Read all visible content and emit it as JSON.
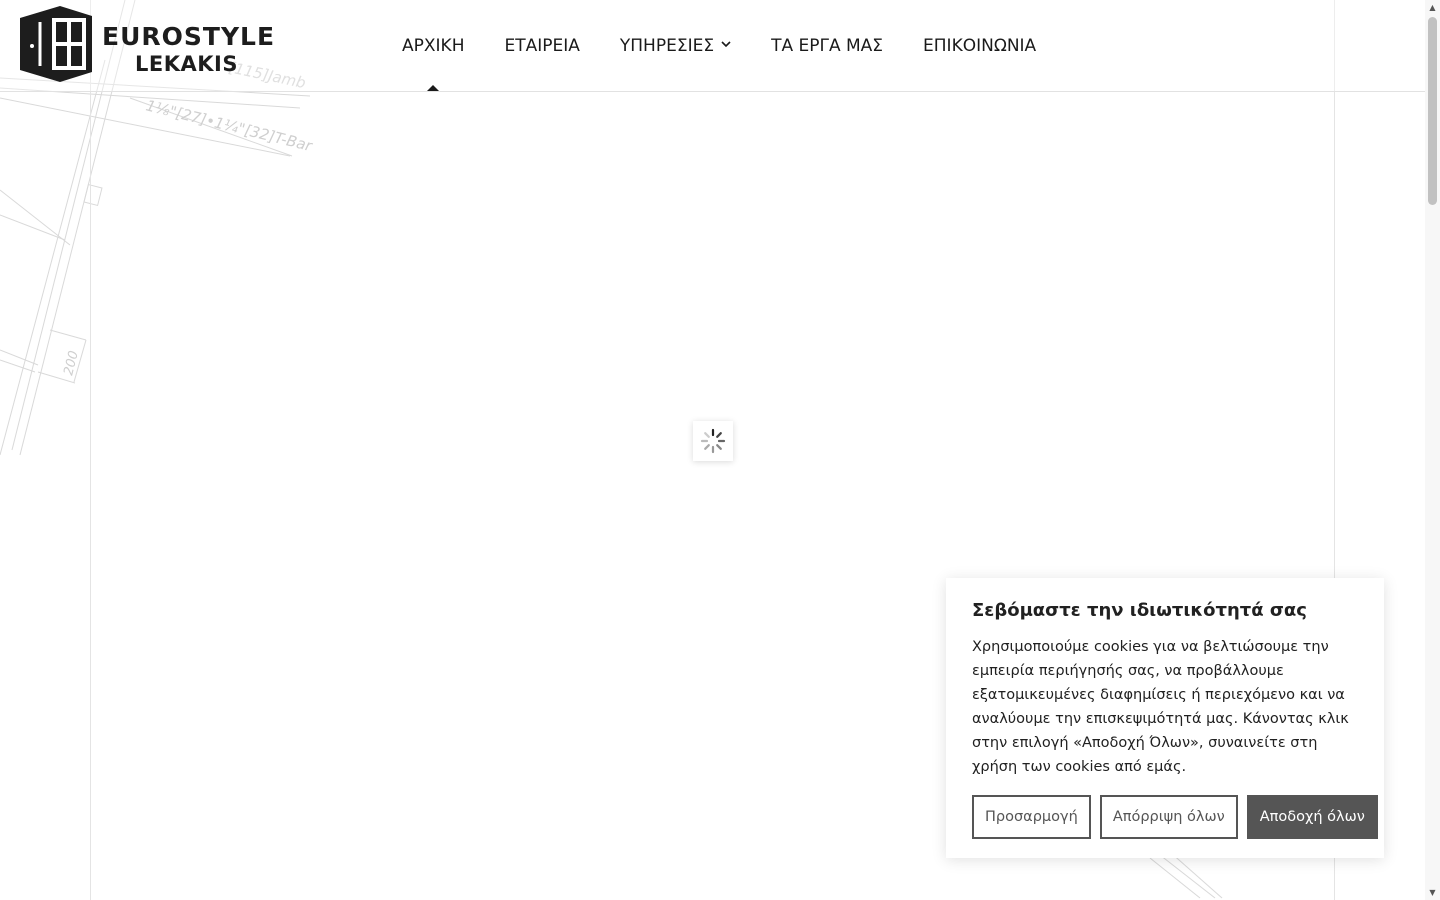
{
  "brand": {
    "line1": "EUROSTYLE",
    "line2": "LEKAKIS"
  },
  "nav": {
    "items": [
      {
        "label": "ΑΡΧΙΚΗ",
        "active": true
      },
      {
        "label": "ΕΤΑΙΡΕΙΑ"
      },
      {
        "label": "ΥΠΗΡΕΣΙΕΣ",
        "has_dropdown": true
      },
      {
        "label": "ΤΑ ΕΡΓΑ ΜΑΣ"
      },
      {
        "label": "ΕΠΙΚΟΙΝΩΝΙΑ"
      }
    ]
  },
  "drawing": {
    "labels": [
      "[115]Jamb",
      "1⅛\"[27]•1¼\"[32]T-Bar",
      "200"
    ]
  },
  "loader": {
    "icon": "spinner-icon"
  },
  "cookie": {
    "title": "Σεβόμαστε την ιδιωτικότητά σας",
    "text": "Χρησιμοποιούμε cookies για να βελτιώσουμε την εμπειρία περιήγησής σας, να προβάλλουμε εξατομικευμένες διαφημίσεις ή περιεχόμενο και να αναλύουμε την επισκεψιμότητά μας. Κάνοντας κλικ στην επιλογή «Αποδοχή Όλων», συναινείτε στη χρήση των cookies από εμάς.",
    "customize_label": "Προσαρμογή",
    "reject_label": "Απόρριψη όλων",
    "accept_label": "Αποδοχή όλων",
    "button_color": "#555555"
  }
}
